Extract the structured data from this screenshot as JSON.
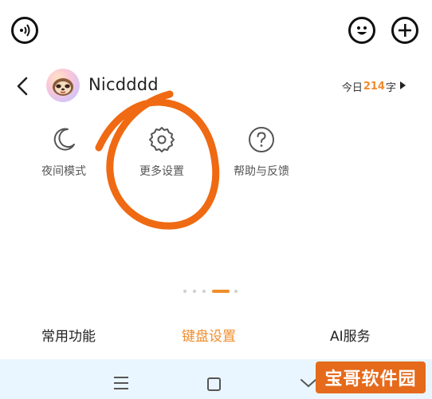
{
  "top_bar": {
    "icons": [
      "voice-icon",
      "emoji-icon",
      "plus-icon"
    ]
  },
  "header": {
    "username": "Nicdddd",
    "today_prefix": "今日",
    "today_count": "214",
    "today_suffix": "字"
  },
  "functions": [
    {
      "label": "夜间模式",
      "icon": "moon-icon"
    },
    {
      "label": "更多设置",
      "icon": "gear-icon"
    },
    {
      "label": "帮助与反馈",
      "icon": "question-icon"
    }
  ],
  "bottom_tabs": [
    {
      "label": "常用功能"
    },
    {
      "label": "键盘设置"
    },
    {
      "label": "AI服务"
    }
  ],
  "colors": {
    "accent": "#f08d2c",
    "annotation": "#ef6a12",
    "navbar_bg": "#eaf6ff"
  },
  "watermark": "宝哥软件园"
}
